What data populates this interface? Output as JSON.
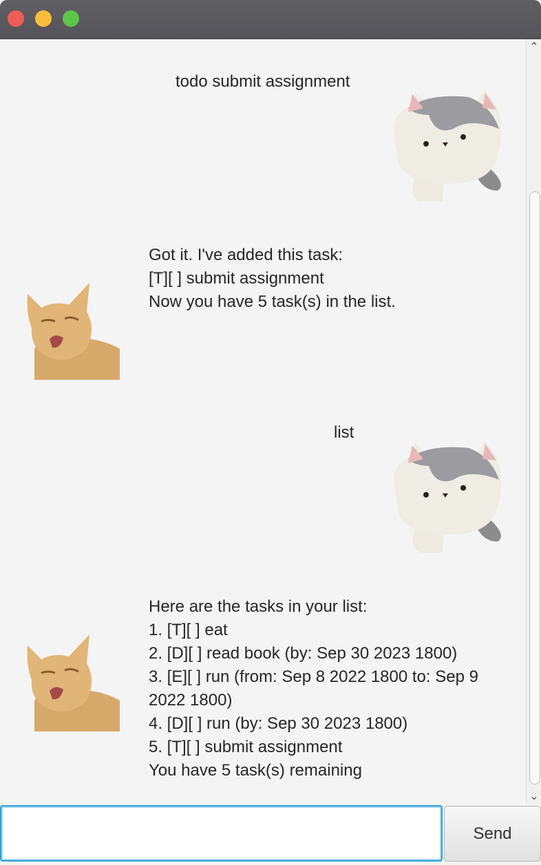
{
  "window": {
    "title": ""
  },
  "messages": [
    {
      "sender": "user",
      "avatar": "plush-cat-avatar",
      "lines": [
        "todo submit assignment"
      ]
    },
    {
      "sender": "bot",
      "avatar": "orange-cat-avatar",
      "lines": [
        "Got it. I've added this task:",
        "[T][ ] submit assignment",
        "Now you have 5 task(s) in the list."
      ]
    },
    {
      "sender": "user",
      "avatar": "plush-cat-avatar",
      "lines": [
        "list"
      ]
    },
    {
      "sender": "bot",
      "avatar": "orange-cat-avatar",
      "lines": [
        "Here are the tasks in your list:",
        "1. [T][ ] eat",
        "2. [D][ ] read book (by: Sep 30 2023 1800)",
        "3. [E][ ] run (from: Sep 8 2022 1800 to: Sep 9",
        "2022 1800)",
        "4. [D][ ] run (by: Sep 30 2023 1800)",
        "5. [T][ ] submit assignment",
        "You have 5 task(s) remaining"
      ]
    }
  ],
  "input": {
    "value": "",
    "placeholder": ""
  },
  "send_button": {
    "label": "Send"
  },
  "colors": {
    "close": "#ee5d57",
    "minimize": "#f6be3b",
    "maximize": "#5fc54b",
    "input_focus": "#2f9fd9"
  }
}
